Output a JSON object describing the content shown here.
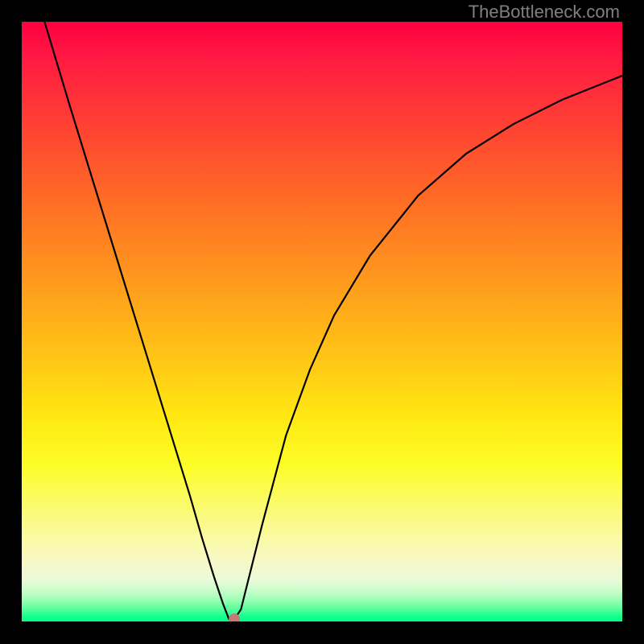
{
  "watermark": "TheBottleneck.com",
  "chart_data": {
    "type": "line",
    "title": "",
    "xlabel": "",
    "ylabel": "",
    "xlim": [
      0,
      100
    ],
    "ylim": [
      0,
      100
    ],
    "watermark": "TheBottleneck.com",
    "background_gradient": {
      "top": "#ff0040",
      "bottom": "#00ff88",
      "stops": [
        "#ff0040",
        "#ff6627",
        "#ffcc15",
        "#fdfd28",
        "#f8f8c8",
        "#00ff88"
      ]
    },
    "series": [
      {
        "name": "bottleneck-curve",
        "color": "#000000",
        "x": [
          3.8,
          8,
          12,
          16,
          20,
          24,
          28,
          30,
          32,
          33.5,
          34.5,
          35.4,
          36.5,
          38,
          40,
          44,
          48,
          52,
          58,
          66,
          74,
          82,
          90,
          98,
          100
        ],
        "y": [
          100,
          86,
          73,
          60,
          47,
          34,
          21,
          14,
          7.5,
          3,
          0.4,
          0.4,
          2,
          8,
          16,
          31,
          42,
          51,
          61,
          71,
          78,
          83,
          87,
          90.2,
          91
        ]
      }
    ],
    "marker": {
      "x": 35.4,
      "y": 0.4,
      "color": "#c97878",
      "radius_px": 7
    },
    "minimum_flat": {
      "x_start": 33.5,
      "x_end": 35.4,
      "y": 0.4
    }
  },
  "colors": {
    "curve": "#000000",
    "marker": "#c97878",
    "frame": "#000000",
    "watermark": "#808080"
  }
}
